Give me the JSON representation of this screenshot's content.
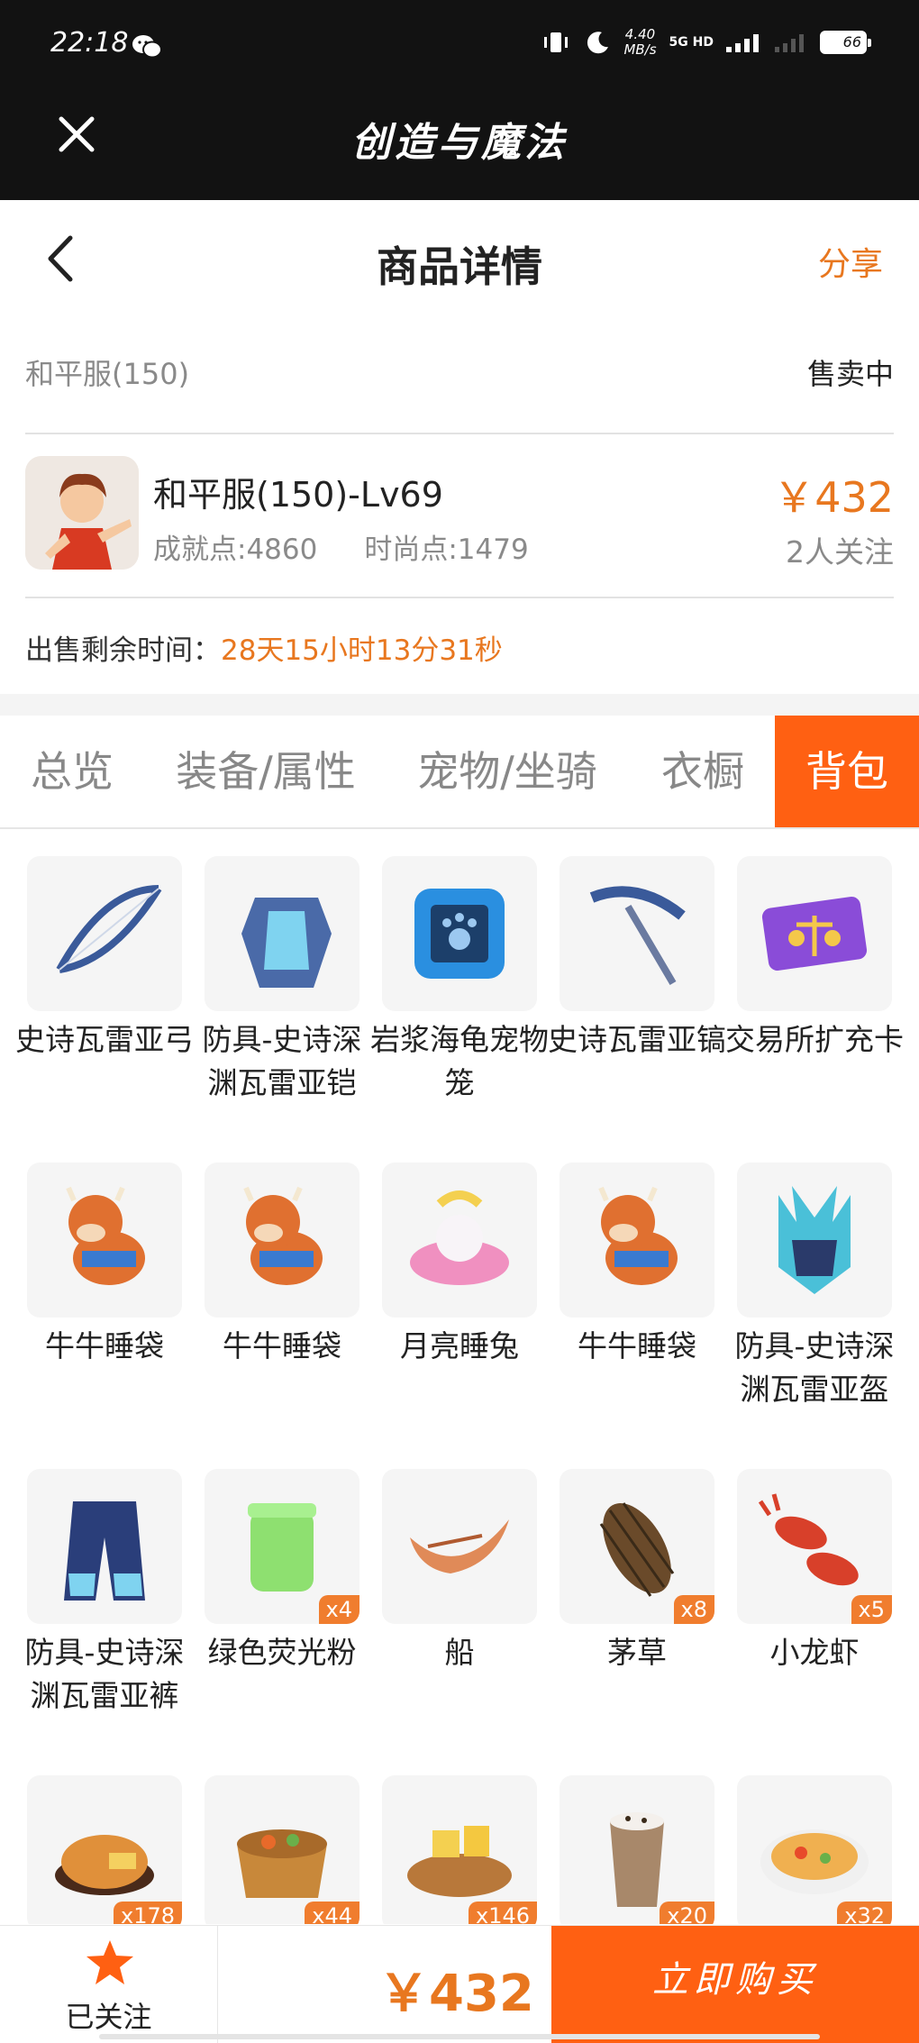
{
  "status": {
    "time": "22:18",
    "speed": "4.40",
    "speed_unit": "MB/s",
    "network": "5G HD",
    "battery": "66"
  },
  "app": {
    "title": "创造与魔法"
  },
  "nav": {
    "title": "商品详情",
    "share": "分享"
  },
  "server": {
    "name": "和平服(150)",
    "status": "售卖中"
  },
  "character": {
    "name": "和平服(150)-Lv69",
    "achievement": "成就点:4860",
    "fashion": "时尚点:1479",
    "price": "￥432",
    "followers": "2人关注"
  },
  "remaining": {
    "label": "出售剩余时间：",
    "countdown": "28天15小时13分31秒"
  },
  "tabs": [
    "总览",
    "装备/属性",
    "宠物/坐骑",
    "衣橱",
    "背包"
  ],
  "active_tab": "背包",
  "items": [
    {
      "name": "史诗瓦雷亚弓",
      "icon": "bow-icon",
      "qty": ""
    },
    {
      "name": "防具-史诗深渊瓦雷亚铠",
      "icon": "armor-icon",
      "qty": ""
    },
    {
      "name": "岩浆海龟宠物笼",
      "icon": "pet-cage-icon",
      "qty": ""
    },
    {
      "name": "史诗瓦雷亚镐",
      "icon": "pickaxe-icon",
      "qty": ""
    },
    {
      "name": "交易所扩充卡",
      "icon": "card-icon",
      "qty": ""
    },
    {
      "name": "牛牛睡袋",
      "icon": "cow-sleeping-bag-icon",
      "qty": ""
    },
    {
      "name": "牛牛睡袋",
      "icon": "cow-sleeping-bag-icon",
      "qty": ""
    },
    {
      "name": "月亮睡兔",
      "icon": "moon-rabbit-icon",
      "qty": ""
    },
    {
      "name": "牛牛睡袋",
      "icon": "cow-sleeping-bag-icon",
      "qty": ""
    },
    {
      "name": "防具-史诗深渊瓦雷亚盔",
      "icon": "helmet-icon",
      "qty": ""
    },
    {
      "name": "防具-史诗深渊瓦雷亚裤",
      "icon": "pants-icon",
      "qty": ""
    },
    {
      "name": "绿色荧光粉",
      "icon": "jar-icon",
      "qty": "x4"
    },
    {
      "name": "船",
      "icon": "boat-icon",
      "qty": ""
    },
    {
      "name": "茅草",
      "icon": "thatch-icon",
      "qty": "x8"
    },
    {
      "name": "小龙虾",
      "icon": "crayfish-icon",
      "qty": "x5"
    },
    {
      "name": "",
      "icon": "fried-food-icon",
      "qty": "x178"
    },
    {
      "name": "",
      "icon": "stew-pot-icon",
      "qty": "x44"
    },
    {
      "name": "",
      "icon": "cake-plate-icon",
      "qty": "x146"
    },
    {
      "name": "",
      "icon": "drink-cup-icon",
      "qty": "x20"
    },
    {
      "name": "",
      "icon": "soup-bowl-icon",
      "qty": "x32"
    }
  ],
  "bottom": {
    "follow_label": "已关注",
    "price": "￥432",
    "buy_label": "立即购买"
  },
  "colors": {
    "accent": "#ff6012",
    "price": "#e8771f",
    "header": "#121212"
  }
}
